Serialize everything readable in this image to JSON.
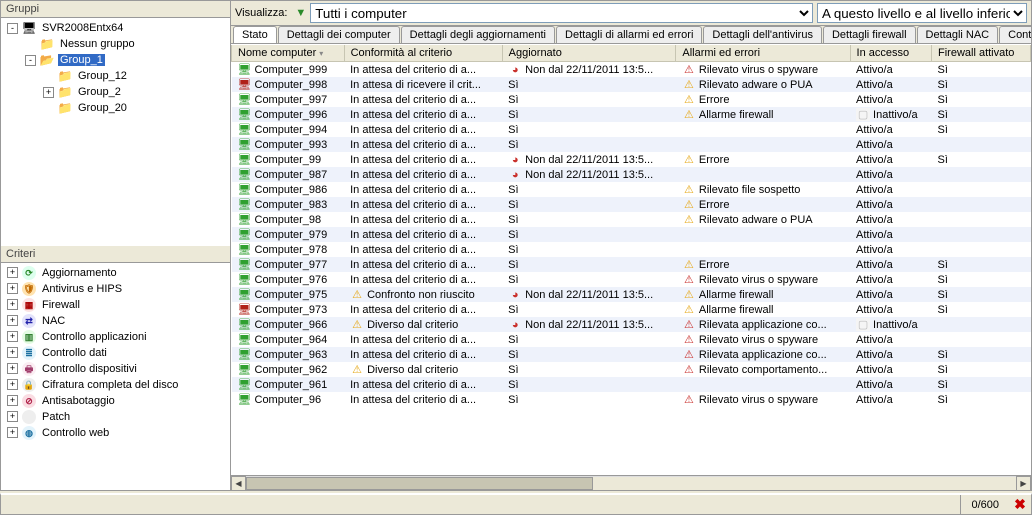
{
  "left": {
    "groups_title": "Gruppi",
    "criteria_title": "Criteri",
    "group_tree": [
      {
        "depth": 0,
        "expand": "-",
        "icon": "server",
        "label": "SVR2008Entx64",
        "sel": false
      },
      {
        "depth": 1,
        "expand": "·",
        "icon": "folder",
        "label": "Nessun gruppo",
        "sel": false
      },
      {
        "depth": 1,
        "expand": "-",
        "icon": "folder-open",
        "label": "Group_1",
        "sel": true
      },
      {
        "depth": 2,
        "expand": "·",
        "icon": "folder",
        "label": "Group_12",
        "sel": false
      },
      {
        "depth": 2,
        "expand": "+",
        "icon": "folder",
        "label": "Group_2",
        "sel": false
      },
      {
        "depth": 2,
        "expand": "·",
        "icon": "folder",
        "label": "Group_20",
        "sel": false
      }
    ],
    "criteria_tree": [
      {
        "expand": "+",
        "cls": "ci-agg",
        "glyph": "⟳",
        "label": "Aggiornamento"
      },
      {
        "expand": "+",
        "cls": "ci-av",
        "glyph": "🛡",
        "label": "Antivirus e HIPS"
      },
      {
        "expand": "+",
        "cls": "ci-fw",
        "glyph": "▦",
        "label": "Firewall"
      },
      {
        "expand": "+",
        "cls": "ci-nac",
        "glyph": "⇄",
        "label": "NAC"
      },
      {
        "expand": "+",
        "cls": "ci-app",
        "glyph": "▥",
        "label": "Controllo applicazioni"
      },
      {
        "expand": "+",
        "cls": "ci-dat",
        "glyph": "≣",
        "label": "Controllo dati"
      },
      {
        "expand": "+",
        "cls": "ci-dev",
        "glyph": "🖶",
        "label": "Controllo dispositivi"
      },
      {
        "expand": "+",
        "cls": "ci-cif",
        "glyph": "🔒",
        "label": "Cifratura completa del disco"
      },
      {
        "expand": "+",
        "cls": "ci-as",
        "glyph": "⊘",
        "label": "Antisabotaggio"
      },
      {
        "expand": "+",
        "cls": "ci-pt",
        "glyph": "",
        "label": "Patch"
      },
      {
        "expand": "+",
        "cls": "ci-web",
        "glyph": "◍",
        "label": "Controllo web"
      }
    ]
  },
  "toolbar": {
    "label": "Visualizza:",
    "filter_option": "Tutti i computer",
    "level_option": "A questo livello e al livello inferiore"
  },
  "tabs": {
    "items": [
      {
        "label": "Stato",
        "active": true
      },
      {
        "label": "Dettagli dei computer",
        "active": false
      },
      {
        "label": "Dettagli degli aggiornamenti",
        "active": false
      },
      {
        "label": "Dettagli di allarmi ed errori",
        "active": false
      },
      {
        "label": "Dettagli dell'antivirus",
        "active": false
      },
      {
        "label": "Dettagli firewall",
        "active": false
      },
      {
        "label": "Dettagli NAC",
        "active": false
      },
      {
        "label": "Controllo app",
        "active": false
      }
    ]
  },
  "grid": {
    "cols": [
      "Nome computer",
      "Conformità al criterio",
      "Aggiornato",
      "Allarmi ed errori",
      "In accesso",
      "Firewall attivato"
    ],
    "rows": [
      {
        "ci": "ok",
        "name": "Computer_999",
        "policy": "In attesa del criterio di a...",
        "u_ico": "bad",
        "updated": "Non dal 22/11/2011 13:5...",
        "a_ico": "err",
        "alert": "Rilevato virus o spyware",
        "acc": "Attivo/a",
        "fw": "Sì"
      },
      {
        "ci": "bad",
        "name": "Computer_998",
        "policy": "In attesa di ricevere il crit...",
        "u_ico": "",
        "updated": "Sì",
        "a_ico": "warn",
        "alert": "Rilevato adware o PUA",
        "acc": "Attivo/a",
        "fw": "Sì"
      },
      {
        "ci": "ok",
        "name": "Computer_997",
        "policy": "In attesa del criterio di a...",
        "u_ico": "",
        "updated": "Sì",
        "a_ico": "warn",
        "alert": "Errore",
        "acc": "Attivo/a",
        "fw": "Sì"
      },
      {
        "ci": "ok",
        "name": "Computer_996",
        "policy": "In attesa del criterio di a...",
        "u_ico": "",
        "updated": "Sì",
        "a_ico": "warn",
        "alert": "Allarme firewall",
        "acc": "Inattivo/a",
        "acc_dis": true,
        "fw": "Sì"
      },
      {
        "ci": "ok",
        "name": "Computer_994",
        "policy": "In attesa del criterio di a...",
        "u_ico": "",
        "updated": "Sì",
        "a_ico": "",
        "alert": "",
        "acc": "Attivo/a",
        "fw": "Sì"
      },
      {
        "ci": "ok",
        "name": "Computer_993",
        "policy": "In attesa del criterio di a...",
        "u_ico": "",
        "updated": "Sì",
        "a_ico": "",
        "alert": "",
        "acc": "Attivo/a",
        "fw": ""
      },
      {
        "ci": "ok",
        "name": "Computer_99",
        "policy": "In attesa del criterio di a...",
        "u_ico": "bad",
        "updated": "Non dal 22/11/2011 13:5...",
        "a_ico": "warn",
        "alert": "Errore",
        "acc": "Attivo/a",
        "fw": "Sì"
      },
      {
        "ci": "ok",
        "name": "Computer_987",
        "policy": "In attesa del criterio di a...",
        "u_ico": "bad",
        "updated": "Non dal 22/11/2011 13:5...",
        "a_ico": "",
        "alert": "",
        "acc": "Attivo/a",
        "fw": ""
      },
      {
        "ci": "ok",
        "name": "Computer_986",
        "policy": "In attesa del criterio di a...",
        "u_ico": "",
        "updated": "Sì",
        "a_ico": "warn",
        "alert": "Rilevato file sospetto",
        "acc": "Attivo/a",
        "fw": ""
      },
      {
        "ci": "ok",
        "name": "Computer_983",
        "policy": "In attesa del criterio di a...",
        "u_ico": "",
        "updated": "Sì",
        "a_ico": "warn",
        "alert": "Errore",
        "acc": "Attivo/a",
        "fw": ""
      },
      {
        "ci": "ok",
        "name": "Computer_98",
        "policy": "In attesa del criterio di a...",
        "u_ico": "",
        "updated": "Sì",
        "a_ico": "warn",
        "alert": "Rilevato adware o PUA",
        "acc": "Attivo/a",
        "fw": ""
      },
      {
        "ci": "ok",
        "name": "Computer_979",
        "policy": "In attesa del criterio di a...",
        "u_ico": "",
        "updated": "Sì",
        "a_ico": "",
        "alert": "",
        "acc": "Attivo/a",
        "fw": ""
      },
      {
        "ci": "ok",
        "name": "Computer_978",
        "policy": "In attesa del criterio di a...",
        "u_ico": "",
        "updated": "Sì",
        "a_ico": "",
        "alert": "",
        "acc": "Attivo/a",
        "fw": ""
      },
      {
        "ci": "ok",
        "name": "Computer_977",
        "policy": "In attesa del criterio di a...",
        "u_ico": "",
        "updated": "Sì",
        "a_ico": "warn",
        "alert": "Errore",
        "acc": "Attivo/a",
        "fw": "Sì"
      },
      {
        "ci": "ok",
        "name": "Computer_976",
        "policy": "In attesa del criterio di a...",
        "u_ico": "",
        "updated": "Sì",
        "a_ico": "err",
        "alert": "Rilevato virus o spyware",
        "acc": "Attivo/a",
        "fw": "Sì"
      },
      {
        "ci": "ok",
        "name": "Computer_975",
        "p_ico": "warn",
        "policy": "Confronto non riuscito",
        "u_ico": "bad",
        "updated": "Non dal 22/11/2011 13:5...",
        "a_ico": "warn",
        "alert": "Allarme firewall",
        "acc": "Attivo/a",
        "fw": "Sì"
      },
      {
        "ci": "bad",
        "name": "Computer_973",
        "policy": "In attesa del criterio di a...",
        "u_ico": "",
        "updated": "Sì",
        "a_ico": "warn",
        "alert": "Allarme firewall",
        "acc": "Attivo/a",
        "fw": "Sì"
      },
      {
        "ci": "ok",
        "name": "Computer_966",
        "p_ico": "warn",
        "policy": "Diverso dal criterio",
        "u_ico": "bad",
        "updated": "Non dal 22/11/2011 13:5...",
        "a_ico": "err",
        "alert": "Rilevata applicazione co...",
        "acc": "Inattivo/a",
        "acc_dis": true,
        "fw": ""
      },
      {
        "ci": "ok",
        "name": "Computer_964",
        "policy": "In attesa del criterio di a...",
        "u_ico": "",
        "updated": "Sì",
        "a_ico": "err",
        "alert": "Rilevato virus o spyware",
        "acc": "Attivo/a",
        "fw": ""
      },
      {
        "ci": "ok",
        "name": "Computer_963",
        "policy": "In attesa del criterio di a...",
        "u_ico": "",
        "updated": "Sì",
        "a_ico": "err",
        "alert": "Rilevata applicazione co...",
        "acc": "Attivo/a",
        "fw": "Sì"
      },
      {
        "ci": "ok",
        "name": "Computer_962",
        "p_ico": "warn",
        "policy": "Diverso dal criterio",
        "u_ico": "",
        "updated": "Sì",
        "a_ico": "err",
        "alert": "Rilevato comportamento...",
        "acc": "Attivo/a",
        "fw": "Sì"
      },
      {
        "ci": "ok",
        "name": "Computer_961",
        "policy": "In attesa del criterio di a...",
        "u_ico": "",
        "updated": "Sì",
        "a_ico": "",
        "alert": "",
        "acc": "Attivo/a",
        "fw": "Sì"
      },
      {
        "ci": "ok",
        "name": "Computer_96",
        "policy": "In attesa del criterio di a...",
        "u_ico": "",
        "updated": "Sì",
        "a_ico": "err",
        "alert": "Rilevato virus o spyware",
        "acc": "Attivo/a",
        "fw": "Sì"
      }
    ]
  },
  "status": {
    "count": "0/600"
  }
}
